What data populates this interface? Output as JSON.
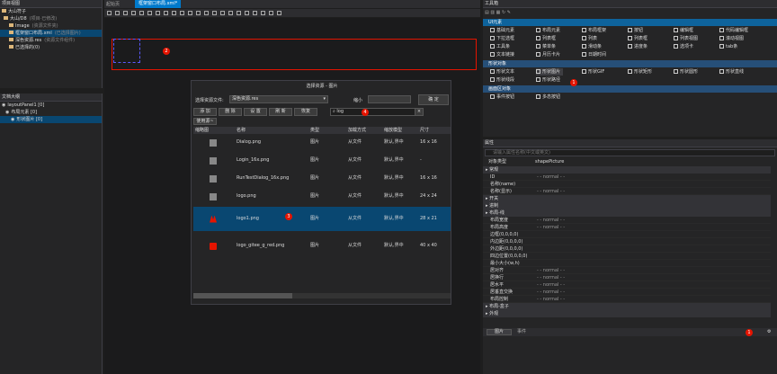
{
  "left_top": {
    "title": "项目视图",
    "items": [
      {
        "label": "大山符子",
        "dim": "",
        "indent": 2
      },
      {
        "label": "大山/D8",
        "dim": "(项目·已修改)",
        "indent": 4
      },
      {
        "label": "Image",
        "dim": "(资源文件夹)",
        "indent": 10
      },
      {
        "label": "框架窗口布局.xml",
        "dim": "(已选择图片)",
        "indent": 10
      },
      {
        "label": "深色资源.res",
        "dim": "(资源文件组件)",
        "indent": 10
      },
      {
        "label": "已选择的(0)",
        "dim": "",
        "indent": 10
      }
    ]
  },
  "left_bottom": {
    "title": "文档大纲",
    "items": [
      {
        "label": "layoutPanel1 [0]",
        "indent": 2
      },
      {
        "label": "布局元素 [0]",
        "indent": 6
      },
      {
        "label": "形状图片 [0]",
        "indent": 12
      }
    ]
  },
  "tabs": [
    "起始页",
    "框架窗口布局.xml*"
  ],
  "dialog": {
    "title": "选择资源 - 图片",
    "source_label": "选择资源文件:",
    "source_value": "深色资源.res",
    "zoom_label": "缩小",
    "ok": "确 定",
    "toolbar": [
      "添 加",
      "删 除",
      "设 置",
      "刷 新",
      "恢复"
    ],
    "search_value": "log",
    "badge_search": "4",
    "group": "使用源~",
    "cols": [
      "缩略图",
      "名称",
      "类型",
      "加载方式",
      "缩放模型",
      "尺寸"
    ],
    "rows": [
      {
        "name": "Dialog.png",
        "type": "图片",
        "load": "从文件",
        "scale": "默认,界中",
        "size": "16 x 16"
      },
      {
        "name": "Login_16x.png",
        "type": "图片",
        "load": "从文件",
        "scale": "默认,界中",
        "size": "-"
      },
      {
        "name": "RunTestDialog_16x.png",
        "type": "图片",
        "load": "从文件",
        "scale": "默认,界中",
        "size": "16 x 16"
      },
      {
        "name": "logo.png",
        "type": "图片",
        "load": "从文件",
        "scale": "默认,界中",
        "size": "24 x 24"
      },
      {
        "name": "logo1.png",
        "type": "图片",
        "load": "从文件",
        "scale": "默认,界中",
        "size": "28 x 21"
      },
      {
        "name": "logo_gitee_g_red.png",
        "type": "图片",
        "load": "从文件",
        "scale": "默认,界中",
        "size": "40 x 40"
      }
    ],
    "badge_row": "3"
  },
  "canvas": {
    "badge": "2"
  },
  "toolbox": {
    "title": "工具箱",
    "sections": [
      {
        "name": "UI元素",
        "items": [
          "基础元素",
          "布局元素",
          "布局框架",
          "按钮",
          "编辑框",
          "代码编辑框",
          "下拉选框",
          "列表框",
          "列表",
          "列表框",
          "列表视图",
          "滚动视图",
          "工具条",
          "菜单条",
          "滑动条",
          "进度条",
          "选项卡",
          "tab条",
          "文本链接",
          "月历卡片",
          "日期时间"
        ]
      },
      {
        "name": "形状对象",
        "items": [
          "形状文本",
          "形状图片",
          "形状GIF",
          "形状矩形",
          "形状圆形",
          "形状直线",
          "形状线段",
          "形状路径"
        ]
      },
      {
        "name": "画面区对象",
        "items": [
          "事件按钮",
          "多态按钮"
        ]
      }
    ],
    "badge": "1"
  },
  "props": {
    "title": "属性",
    "search_placeholder": "请输入属性名称(中文或英文)",
    "obj_label": "对象类型",
    "obj_value": "shapePicture",
    "rows": [
      {
        "g": "常规"
      },
      {
        "k": "ID",
        "v": "- - normal - -"
      },
      {
        "k": "名称(name)",
        "v": ""
      },
      {
        "k": "名称(显示)",
        "v": "- - normal - -"
      },
      {
        "g": "开关"
      },
      {
        "g": "进制"
      },
      {
        "g": "布局-线"
      },
      {
        "k": "布局宽度",
        "v": "- - normal - -"
      },
      {
        "k": "布局高度",
        "v": "- - normal - -"
      },
      {
        "k": "边框(0,0,0,0)",
        "v": ""
      },
      {
        "k": "内边距(0,0,0,0)",
        "v": ""
      },
      {
        "k": "外边距(0,0,0,0)",
        "v": ""
      },
      {
        "k": "四边位置(0,0,0,0)",
        "v": ""
      },
      {
        "k": "最小大小(w,h)",
        "v": ""
      },
      {
        "k": "居对齐",
        "v": "- - normal - -"
      },
      {
        "k": "居换行",
        "v": "- - normal - -"
      },
      {
        "k": "居水平",
        "v": "- - normal - -"
      },
      {
        "k": "居垂直交换",
        "v": "- - normal - -"
      },
      {
        "k": "布局控制",
        "v": "- - normal - -"
      },
      {
        "g": "布局-盒子"
      },
      {
        "g": "外观"
      }
    ],
    "tabs": [
      "图片",
      "事件"
    ],
    "badge": "1"
  }
}
